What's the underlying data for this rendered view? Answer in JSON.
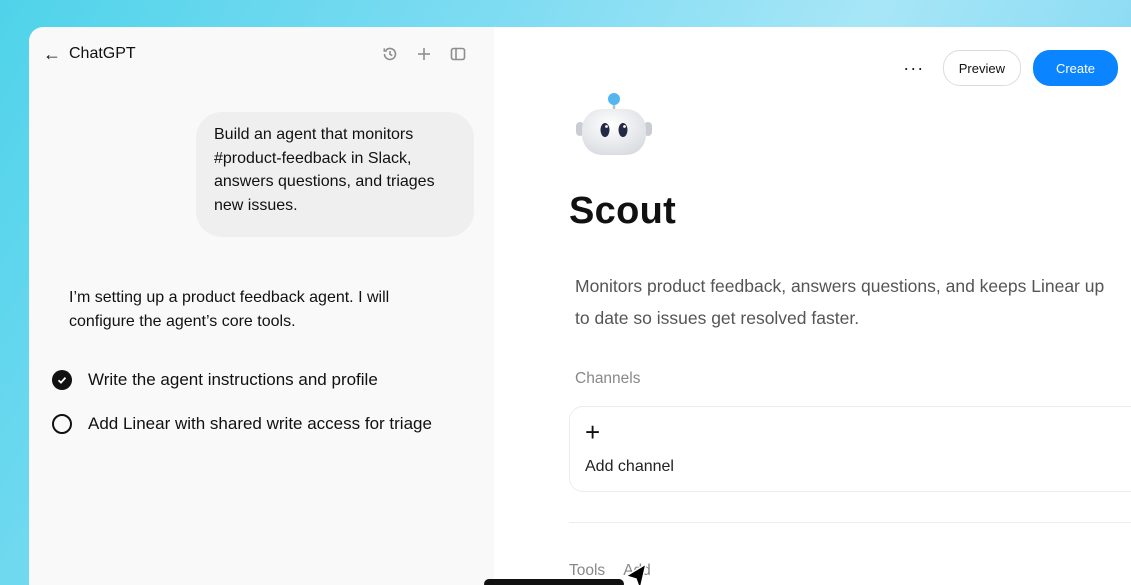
{
  "left_panel": {
    "title": "ChatGPT",
    "user_message": "Build an agent that monitors #product-feedback in Slack, answers questions, and triages new issues.",
    "assistant_message": "I’m setting up a product feedback agent. I will configure the agent’s core tools.",
    "tasks": [
      {
        "label": "Write the agent instructions and profile",
        "status": "done"
      },
      {
        "label": "Add Linear with shared write access for triage",
        "status": "pending"
      }
    ]
  },
  "right_panel": {
    "more_label": "···",
    "preview_label": "Preview",
    "create_label": "Create",
    "agent_name": "Scout",
    "agent_description": "Monitors product feedback, answers questions, and keeps Linear up to date so issues get resolved faster.",
    "channels_label": "Channels",
    "add_channel_label": "Add channel",
    "add_channel_icon": "+",
    "tools_label": "Tools",
    "add_tool_label": "Add"
  },
  "icons": {
    "back": "back-arrow-icon",
    "history": "history-icon",
    "new": "plus-icon",
    "sidebar": "sidebar-toggle-icon",
    "avatar": "robot-avatar-icon"
  },
  "colors": {
    "accent": "#0a84ff",
    "background_gradient": "#4fd3ea"
  }
}
